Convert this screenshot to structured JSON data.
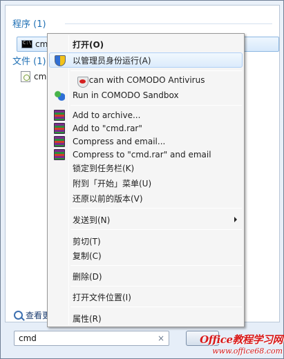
{
  "results": {
    "programs_header": "程序 (1)",
    "files_header": "文件 (1)",
    "program_item": "cmd",
    "file_item": "cmd"
  },
  "see_more": "查看更",
  "search": {
    "value": "cmd",
    "clear": "×"
  },
  "context_menu": {
    "items": [
      {
        "label": "打开(O)",
        "icon": "none",
        "default": true
      },
      {
        "label": "以管理员身份运行(A)",
        "icon": "uac-shield-icon",
        "hover": true
      },
      {
        "label": "Scan with COMODO Antivirus",
        "icon": "comodo-antivirus-icon"
      },
      {
        "label": "Run in COMODO Sandbox",
        "icon": "comodo-sandbox-icon"
      },
      {
        "label": "Add to archive...",
        "icon": "winrar-icon"
      },
      {
        "label": "Add to \"cmd.rar\"",
        "icon": "winrar-icon"
      },
      {
        "label": "Compress and email...",
        "icon": "winrar-icon"
      },
      {
        "label": "Compress to \"cmd.rar\" and email",
        "icon": "winrar-icon"
      },
      {
        "label": "锁定到任务栏(K)",
        "icon": "none"
      },
      {
        "label": "附到「开始」菜单(U)",
        "icon": "none"
      },
      {
        "label": "还原以前的版本(V)",
        "icon": "none"
      },
      {
        "label": "发送到(N)",
        "icon": "none",
        "submenu": true
      },
      {
        "label": "剪切(T)",
        "icon": "none"
      },
      {
        "label": "复制(C)",
        "icon": "none"
      },
      {
        "label": "删除(D)",
        "icon": "none"
      },
      {
        "label": "打开文件位置(I)",
        "icon": "none"
      },
      {
        "label": "属性(R)",
        "icon": "none"
      }
    ]
  },
  "watermark": {
    "main": "Office教程学习网",
    "url": "www.office68.com"
  },
  "colors": {
    "group_header": "#1e6fb4",
    "menu_bg": "#f5f5f5",
    "highlight_border": "#aecff7",
    "watermark": "#d81a1a"
  }
}
